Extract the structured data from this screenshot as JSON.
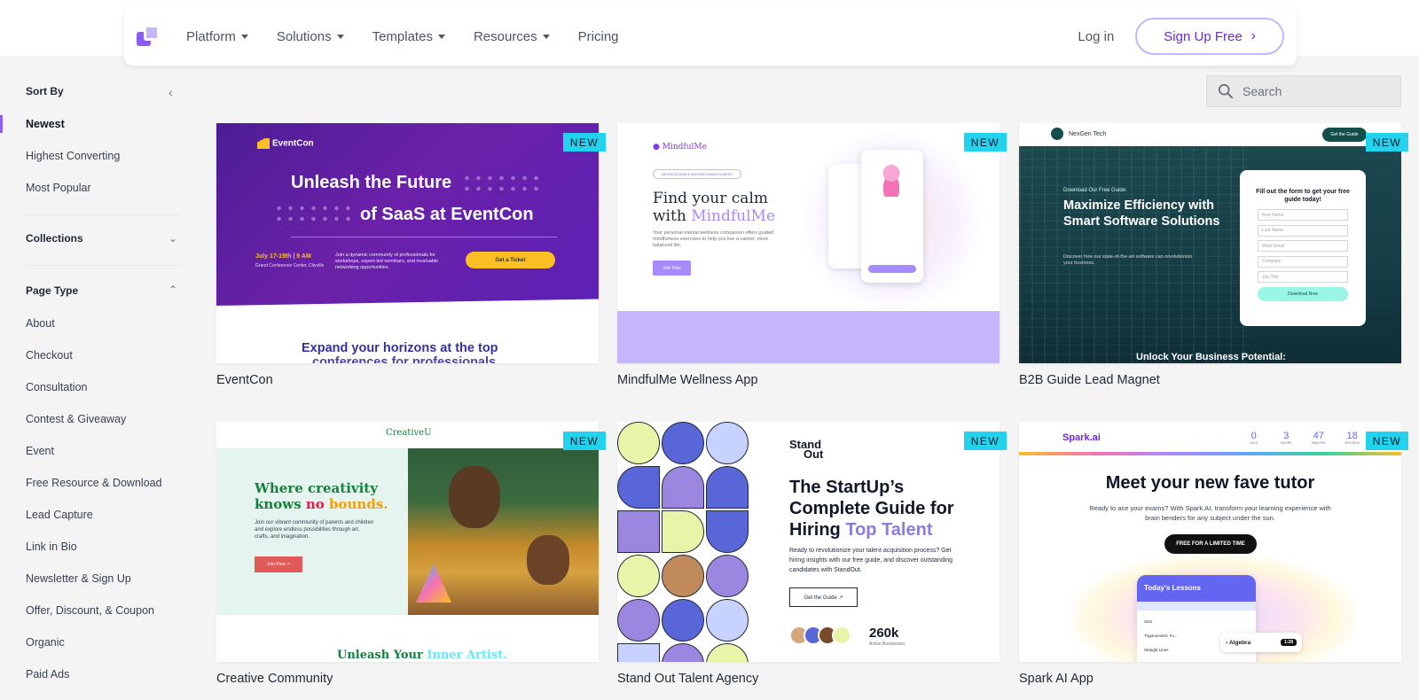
{
  "nav": {
    "items": [
      {
        "label": "Platform",
        "has_caret": true
      },
      {
        "label": "Solutions",
        "has_caret": true
      },
      {
        "label": "Templates",
        "has_caret": true
      },
      {
        "label": "Resources",
        "has_caret": true
      },
      {
        "label": "Pricing",
        "has_caret": false
      }
    ],
    "login_label": "Log in",
    "signup_label": "Sign Up Free"
  },
  "sidebar": {
    "sort_by_label": "Sort By",
    "sort_options": [
      {
        "label": "Newest",
        "active": true
      },
      {
        "label": "Highest Converting",
        "active": false
      },
      {
        "label": "Most Popular",
        "active": false
      }
    ],
    "collections_label": "Collections",
    "page_type_label": "Page Type",
    "page_types": [
      "About",
      "Checkout",
      "Consultation",
      "Contest & Giveaway",
      "Event",
      "Free Resource & Download",
      "Lead Capture",
      "Link in Bio",
      "Newsletter & Sign Up",
      "Offer, Discount, & Coupon",
      "Organic",
      "Paid Ads"
    ]
  },
  "search": {
    "placeholder": "Search"
  },
  "badge_label": "NEW",
  "cards": [
    {
      "title": "EventCon",
      "preview": {
        "logo": "EventCon",
        "headline_1": "Unleash the Future",
        "headline_2": "of SaaS at EventCon",
        "date": "July 17-19th | 9 AM",
        "venue": "Grand Conference Center, Cityville",
        "desc": "Join a dynamic community of professionals for workshops, expert-led seminars, and invaluable networking opportunities.",
        "cta": "Get a Ticket",
        "footer_1": "Expand your horizons at the top",
        "footer_2": "conferences for professionals"
      }
    },
    {
      "title": "MindfulMe Wellness App",
      "preview": {
        "logo": "MindfulMe",
        "pill": "NEUROSCIENCE-BACKED MINDFULNESS",
        "headline_1": "Find your calm",
        "headline_2a": "with ",
        "headline_2b": "MindfulMe",
        "desc": "Your personal mental wellness companion offers guided mindfulness exercises to help you live a calmer, more balanced life.",
        "cta": "Join Free"
      }
    },
    {
      "title": "B2B Guide Lead Magnet",
      "preview": {
        "logo": "NexGen Tech",
        "top_cta": "Get the Guide",
        "pre": "Download Our Free Guide:",
        "headline": "Maximize Efficiency with Smart Software Solutions",
        "desc": "Discover how our state-of-the-art software can revolutionize your business.",
        "form_title": "Fill out the form to get your free guide today!",
        "fields": [
          "First Name",
          "Last Name",
          "Work Email",
          "Company",
          "Job Title"
        ],
        "form_cta": "Download Now",
        "footer": "Unlock Your Business Potential:"
      }
    },
    {
      "title": "Creative Community",
      "preview": {
        "logo": "CreativeU",
        "headline_1": "Where creativity",
        "headline_2a": "knows ",
        "headline_2b": "no",
        "headline_2c": " bounds.",
        "desc": "Join our vibrant community of parents and children and explore endless possibilities through art, crafts, and imagination.",
        "cta": "Join Free ↗",
        "footer_a": "Unleash Your ",
        "footer_b": "Inner Artist."
      }
    },
    {
      "title": "Stand Out Talent Agency",
      "preview": {
        "logo_1": "Stand",
        "logo_2": "Out",
        "headline_1": "The StartUp’s Complete Guide for Hiring ",
        "headline_2": "Top Talent",
        "desc": "Ready to revolutionize your talent acquisition process? Get hiring insights with our free guide, and discover outstanding candidates with StandOut.",
        "cta": "Get the Guide ↗",
        "stat": "260k",
        "stat_label": "Active Businesses"
      }
    },
    {
      "title": "Spark AI App",
      "preview": {
        "logo": "Spark.ai",
        "countdown": [
          {
            "n": "0",
            "l": "DAYS"
          },
          {
            "n": "3",
            "l": "HOURS"
          },
          {
            "n": "47",
            "l": "MINUTES"
          },
          {
            "n": "18",
            "l": "SECONDS"
          }
        ],
        "headline": "Meet your new fave tutor",
        "desc": "Ready to ace your exams? With Spark.AI, transform your learning experience with brain benders for any subject under the sun.",
        "cta": "FREE FOR A LIMITED TIME",
        "app_title": "Today's Lessons",
        "rows": [
          "Sets",
          "Trigonometric Fu...",
          "Straight Lines"
        ],
        "chip_label": "Algebra",
        "chip_timer": "1:28"
      }
    }
  ],
  "colors": {
    "accent": "#8b5cf6",
    "badge": "#22d3ee",
    "signup_border": "#c4b5fd"
  }
}
